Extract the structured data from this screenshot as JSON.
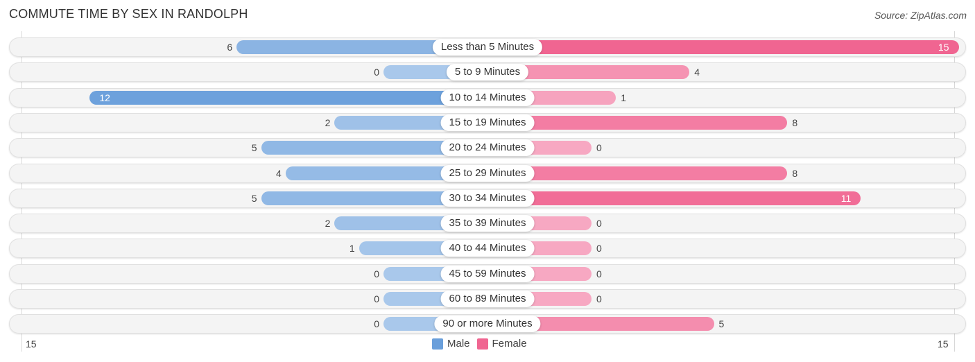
{
  "title": "COMMUTE TIME BY SEX IN RANDOLPH",
  "source": "Source: ZipAtlas.com",
  "colors": {
    "male_strong": "#6a9fdb",
    "male_light": "#a9c8eb",
    "female_strong": "#f06591",
    "female_light": "#f7a8c2"
  },
  "chart_data": {
    "type": "bar",
    "orientation": "horizontal-diverging",
    "title": "COMMUTE TIME BY SEX IN RANDOLPH",
    "categories": [
      "Less than 5 Minutes",
      "5 to 9 Minutes",
      "10 to 14 Minutes",
      "15 to 19 Minutes",
      "20 to 24 Minutes",
      "25 to 29 Minutes",
      "30 to 34 Minutes",
      "35 to 39 Minutes",
      "40 to 44 Minutes",
      "45 to 59 Minutes",
      "60 to 89 Minutes",
      "90 or more Minutes"
    ],
    "series": [
      {
        "name": "Male",
        "values": [
          6,
          0,
          12,
          2,
          5,
          4,
          5,
          2,
          1,
          0,
          0,
          0
        ]
      },
      {
        "name": "Female",
        "values": [
          15,
          4,
          1,
          8,
          0,
          8,
          11,
          0,
          0,
          0,
          0,
          5
        ]
      }
    ],
    "axis_ticks": {
      "left": "15",
      "right": "15"
    },
    "xlim": [
      -15,
      15
    ],
    "legend": {
      "position": "bottom-center",
      "items": [
        "Male",
        "Female"
      ]
    }
  }
}
